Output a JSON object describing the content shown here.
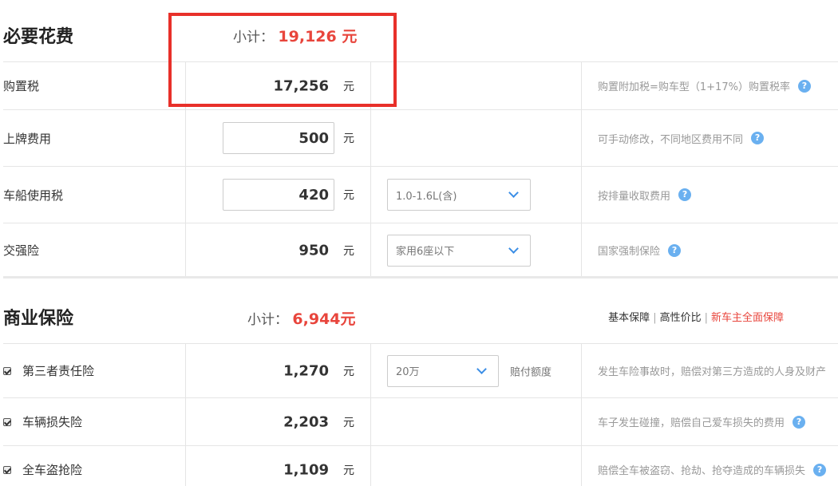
{
  "required": {
    "title": "必要花费",
    "subtotal_label": "小计：",
    "subtotal_value": "19,126 元",
    "rows": [
      {
        "label": "购置税",
        "amount": "17,256",
        "unit": "元",
        "desc": "购置附加税=购车型（1+17%）购置税率"
      },
      {
        "label": "上牌费用",
        "amount": "500",
        "unit": "元",
        "desc": "可手动修改，不同地区费用不同"
      },
      {
        "label": "车船使用税",
        "amount": "420",
        "unit": "元",
        "select": "1.0-1.6L(含)",
        "desc": "按排量收取费用"
      },
      {
        "label": "交强险",
        "amount": "950",
        "unit": "元",
        "select": "家用6座以下",
        "desc": "国家强制保险"
      }
    ]
  },
  "commercial": {
    "title": "商业保险",
    "subtotal_label": "小计：",
    "subtotal_value": "6,944元",
    "plans": {
      "basic": "基本保障",
      "value": "高性价比",
      "full": "新车主全面保障",
      "separator": "|"
    },
    "rows": [
      {
        "label": "第三者责任险",
        "checked": true,
        "amount": "1,270",
        "unit": "元",
        "select": "20万",
        "select_note": "赔付额度",
        "desc": "发生车险事故时，赔偿对第三方造成的人身及财产"
      },
      {
        "label": "车辆损失险",
        "checked": true,
        "amount": "2,203",
        "unit": "元",
        "desc": "车子发生碰撞，赔偿自己爱车损失的费用"
      },
      {
        "label": "全车盗抢险",
        "checked": true,
        "amount": "1,109",
        "unit": "元",
        "desc": "赔偿全车被盗窃、抢劫、抢夺造成的车辆损失"
      }
    ]
  },
  "icons": {
    "help": "?",
    "help_icon": "help-circle-icon",
    "chevron": "chevron-down-icon",
    "checkbox": "checkbox-checked-icon"
  },
  "colors": {
    "accent_red": "#e8453c",
    "help_blue": "#6ab0f0",
    "chevron_blue": "#3b8ee6",
    "annotation_red": "#e8302a"
  }
}
